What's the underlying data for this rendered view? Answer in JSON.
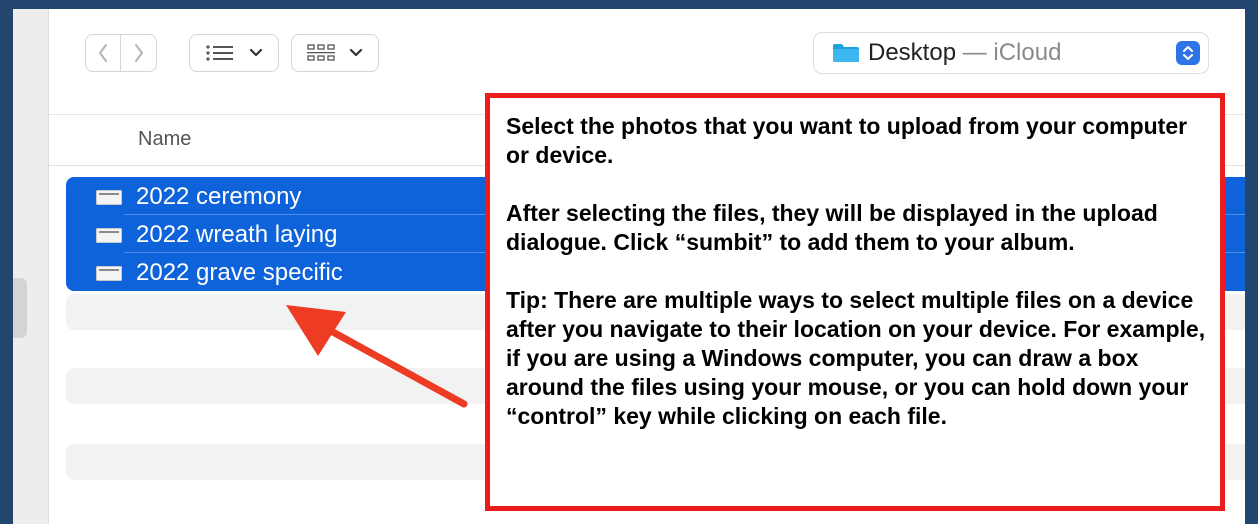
{
  "toolbar": {
    "back_icon": "chevron-left-icon",
    "forward_icon": "chevron-right-icon",
    "list_view_icon": "list-view-icon",
    "grid_view_icon": "grid-view-icon",
    "location": {
      "folder": "Desktop",
      "separator": "—",
      "service": "iCloud"
    }
  },
  "file_list": {
    "column_header": "Name",
    "files": [
      {
        "name": "2022 ceremony",
        "selected": true
      },
      {
        "name": "2022 wreath laying",
        "selected": true
      },
      {
        "name": "2022 grave specific",
        "selected": true
      }
    ]
  },
  "callout": {
    "paragraph_1": "Select the photos that you want to upload from your computer or device.",
    "paragraph_2": "After selecting the files, they will be displayed in the upload dialogue. Click “sumbit” to add them to your album.",
    "paragraph_3": "Tip: There are multiple ways to select multiple files on a device after you navigate to their location on your device. For example, if you are using a Windows computer, you can draw a box around the files using your mouse, or you can hold down your “control” key while clicking on each file."
  },
  "colors": {
    "selection": "#0f63da",
    "callout_border": "#ec1c1c",
    "arrow": "#ee3b24",
    "background": "#23466f"
  }
}
